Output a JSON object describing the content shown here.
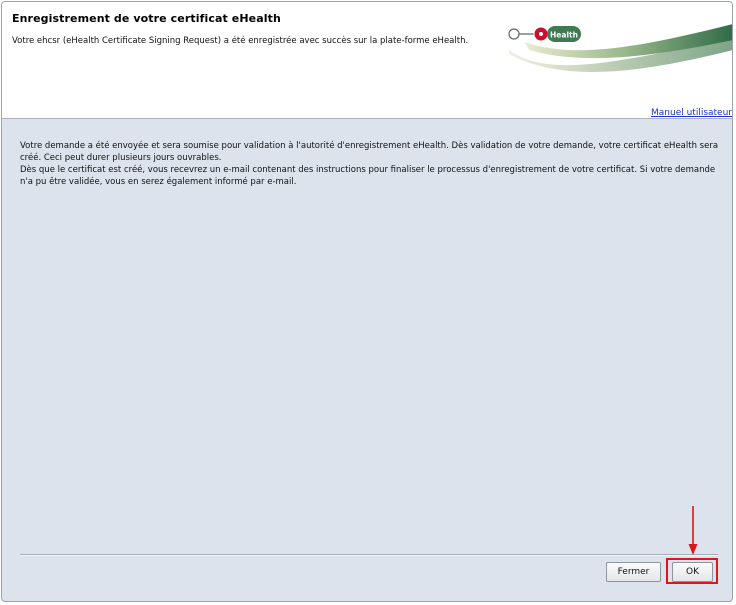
{
  "dialog": {
    "title": "Enregistrement de votre certificat eHealth",
    "subtitle": "Votre ehcsr (eHealth Certificate Signing Request) a été enregistrée avec succès sur la plate-forme eHealth.",
    "logo_text": "Health",
    "manual_link": "Manuel utilisateur"
  },
  "message": {
    "paragraph1": "Votre demande a été envoyée et sera soumise pour validation à l'autorité d'enregistrement eHealth. Dès validation de votre demande, votre certificat eHealth sera créé. Ceci peut durer plusieurs jours ouvrables.",
    "paragraph2": "Dès que le certificat est créé, vous recevrez un e-mail contenant des instructions pour finaliser le processus d'enregistrement de votre certificat. Si votre demande n'a pu être validée, vous en serez également informé par e-mail."
  },
  "buttons": {
    "close_label": "Fermer",
    "ok_label": "OK"
  },
  "colors": {
    "logo_green": "#3e7a52",
    "logo_red": "#c8102e",
    "highlight_red": "#e01515",
    "link_blue": "#1a35c8"
  }
}
